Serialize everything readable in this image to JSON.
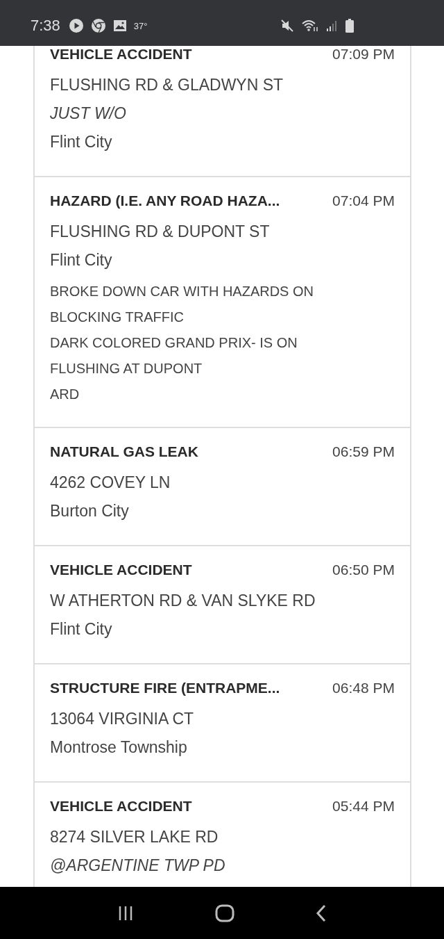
{
  "status_bar": {
    "time": "7:38",
    "temperature": "37°"
  },
  "incidents": [
    {
      "title": "VEHICLE ACCIDENT",
      "time": "07:09 PM",
      "lines": [
        {
          "kind": "address",
          "text": "FLUSHING RD & GLADWYN ST"
        },
        {
          "kind": "note",
          "text": "JUST W/O"
        },
        {
          "kind": "city",
          "text": "Flint City"
        }
      ]
    },
    {
      "title": "HAZARD (I.E. ANY ROAD HAZA...",
      "time": "07:04 PM",
      "lines": [
        {
          "kind": "address",
          "text": "FLUSHING RD & DUPONT ST"
        },
        {
          "kind": "city",
          "text": "Flint City"
        },
        {
          "kind": "detail",
          "text": "BROKE DOWN CAR WITH HAZARDS ON"
        },
        {
          "kind": "detail",
          "text": "BLOCKING TRAFFIC"
        },
        {
          "kind": "detail",
          "text": "DARK COLORED GRAND PRIX- IS ON"
        },
        {
          "kind": "detail",
          "text": "FLUSHING AT DUPONT"
        },
        {
          "kind": "detail",
          "text": "ARD"
        }
      ]
    },
    {
      "title": "NATURAL GAS LEAK",
      "time": "06:59 PM",
      "lines": [
        {
          "kind": "address",
          "text": "4262 COVEY LN"
        },
        {
          "kind": "city",
          "text": "Burton City"
        }
      ]
    },
    {
      "title": "VEHICLE ACCIDENT",
      "time": "06:50 PM",
      "lines": [
        {
          "kind": "address",
          "text": "W ATHERTON RD & VAN SLYKE RD"
        },
        {
          "kind": "city",
          "text": "Flint City"
        }
      ]
    },
    {
      "title": "STRUCTURE FIRE (ENTRAPME...",
      "time": "06:48 PM",
      "lines": [
        {
          "kind": "address",
          "text": "13064 VIRGINIA CT"
        },
        {
          "kind": "city",
          "text": "Montrose Township"
        }
      ]
    },
    {
      "title": "VEHICLE ACCIDENT",
      "time": "05:44 PM",
      "lines": [
        {
          "kind": "address",
          "text": "8274 SILVER LAKE RD"
        },
        {
          "kind": "note",
          "text": "@ARGENTINE TWP PD"
        }
      ]
    }
  ]
}
